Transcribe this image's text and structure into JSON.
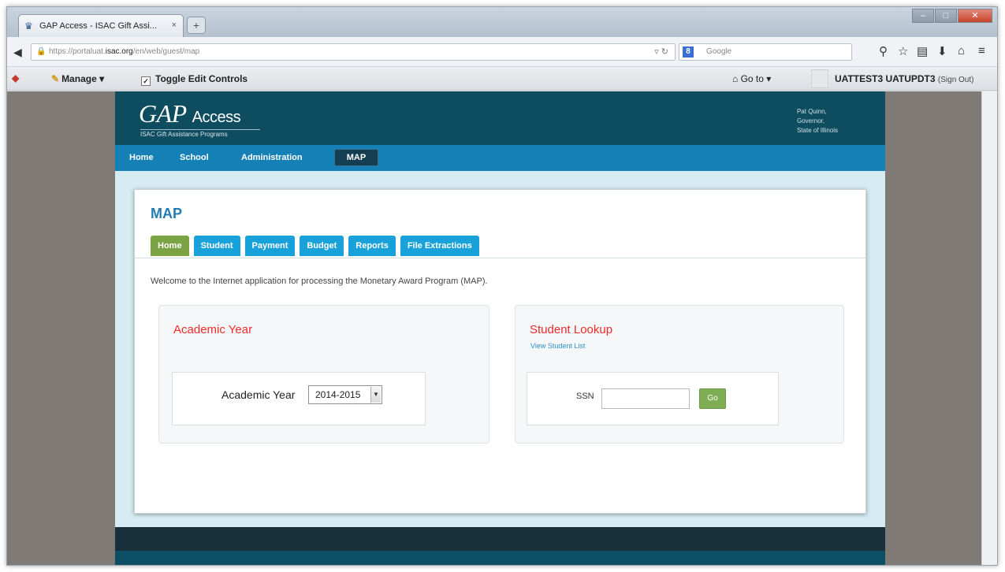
{
  "browser": {
    "tab_title": "GAP Access - ISAC Gift Assi...",
    "tab_close": "×",
    "new_tab": "+",
    "url_prefix": "https://portaluat.",
    "url_host": "isac.org",
    "url_path": "/en/web/guest/map",
    "search_engine": "Google",
    "icons": [
      "back-icon",
      "lock-icon",
      "reload-icon",
      "search-icon",
      "star-icon",
      "reading-list-icon",
      "download-icon",
      "home-icon",
      "menu-icon"
    ]
  },
  "dockbar": {
    "manage": "Manage ▾",
    "toggle": "Toggle Edit Controls",
    "goto": "Go to ▾",
    "user_name": "UATTEST3 UATUPDT3",
    "sign_out": "(Sign Out)"
  },
  "site": {
    "logo_main": "GAP",
    "logo_access": "Access",
    "logo_sub": "ISAC Gift Assistance Programs",
    "gov_line1": "Pat Quinn,",
    "gov_line2": "Governor,",
    "gov_line3": "State of Illinois",
    "nav": [
      "Home",
      "School",
      "Administration",
      "MAP"
    ]
  },
  "panel": {
    "title": "MAP",
    "tabs": [
      "Home",
      "Student",
      "Payment",
      "Budget",
      "Reports",
      "File Extractions"
    ],
    "active_tab": "Home",
    "welcome": "Welcome to the Internet application for processing the Monetary Award Program (MAP).",
    "year_card_title": "Academic Year",
    "year_label": "Academic Year",
    "year_value": "2014-2015",
    "student_card_title": "Student Lookup",
    "view_list": "View Student List",
    "ssn_label": "SSN",
    "ssn_value": "",
    "go": "Go"
  },
  "colors": {
    "header": "#0e4c5f",
    "nav": "#1580b5",
    "tab_active": "#7aa443",
    "tab": "#19a1d9",
    "card_heading": "#f02a2a"
  }
}
